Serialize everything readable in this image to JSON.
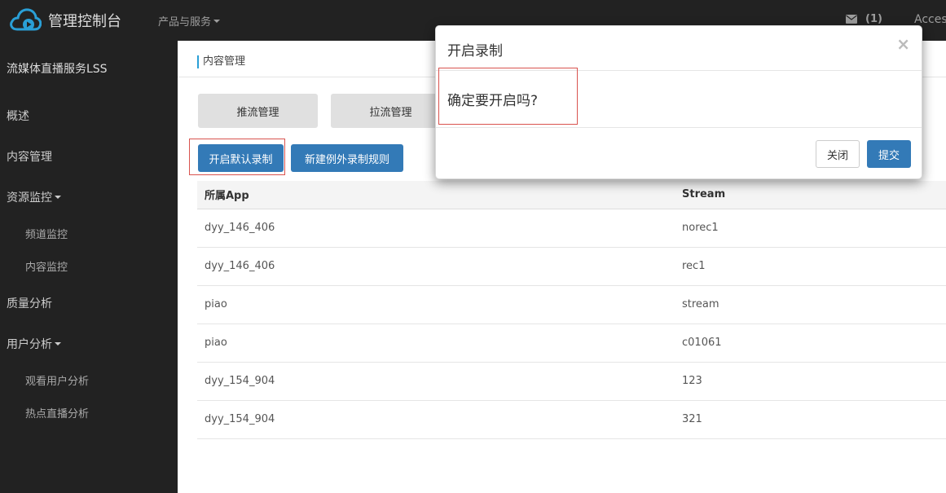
{
  "header": {
    "app_title": "管理控制台",
    "products_label": "产品与服务",
    "message_count": "(1)",
    "access_label": "Access"
  },
  "sidebar": {
    "service_title": "流媒体直播服务LSS",
    "items": [
      {
        "label": "概述"
      },
      {
        "label": "内容管理"
      },
      {
        "label": "资源监控"
      },
      {
        "label": "频道监控"
      },
      {
        "label": "内容监控"
      },
      {
        "label": "质量分析"
      },
      {
        "label": "用户分析"
      },
      {
        "label": "观看用户分析"
      },
      {
        "label": "热点直播分析"
      }
    ]
  },
  "main": {
    "breadcrumb": "内容管理",
    "tabs": [
      {
        "label": "推流管理"
      },
      {
        "label": "拉流管理"
      }
    ],
    "actions": {
      "enable_default_record": "开启默认录制",
      "new_exception_rule": "新建例外录制规则"
    },
    "table": {
      "headers": [
        "所属App",
        "Stream"
      ],
      "rows": [
        [
          "dyy_146_406",
          "norec1"
        ],
        [
          "dyy_146_406",
          "rec1"
        ],
        [
          "piao",
          "stream"
        ],
        [
          "piao",
          "c01061"
        ],
        [
          "dyy_154_904",
          "123"
        ],
        [
          "dyy_154_904",
          "321"
        ]
      ]
    }
  },
  "modal": {
    "title": "开启录制",
    "close_symbol": "×",
    "message": "确定要开启吗?",
    "cancel_label": "关闭",
    "submit_label": "提交"
  },
  "colors": {
    "topbar_bg": "#222222",
    "primary": "#337ab7",
    "highlight": "#d9534f",
    "accent": "#2a9fd6"
  }
}
